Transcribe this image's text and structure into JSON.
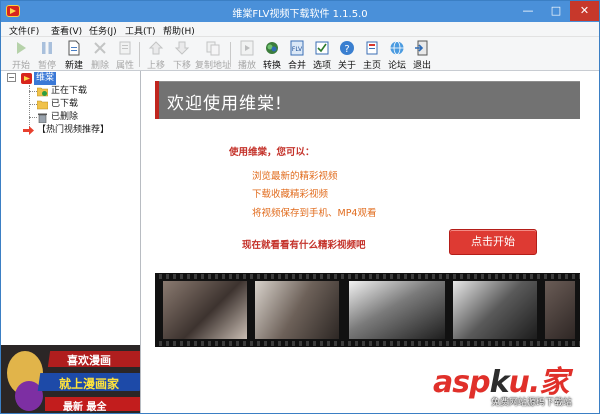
{
  "window": {
    "title": "维棠FLV视频下载软件 1.1.5.0",
    "controls": {
      "minimize": "—",
      "maximize": "□",
      "close": "✕"
    }
  },
  "menu": [
    "文件(F)",
    "查看(V)",
    "任务(J)",
    "工具(T)",
    "帮助(H)"
  ],
  "toolbar": {
    "start": "开始",
    "pause": "暂停",
    "new": "新建",
    "delete": "删除",
    "properties": "属性",
    "move_up": "上移",
    "move_down": "下移",
    "copy_url": "复制地址",
    "play": "播放",
    "convert": "转换",
    "merge": "合并",
    "options": "选项",
    "about": "关于",
    "home": "主页",
    "forum": "论坛",
    "exit": "退出"
  },
  "tree": {
    "root": "维棠",
    "downloading": "正在下载",
    "downloaded": "已下载",
    "deleted": "已删除",
    "recommend": "【热门视频推荐】"
  },
  "ad": {
    "line1": "喜欢漫画",
    "line2": "就上漫画家",
    "line3": "最新 最全"
  },
  "welcome": {
    "title": "欢迎使用维棠!",
    "intro": "使用维棠，您可以：",
    "bullets": [
      "浏览最新的精彩视频",
      "下载收藏精彩视频",
      "将视频保存到手机、MP4观看"
    ],
    "cta": "现在就看看有什么精彩视频吧",
    "start_button": "点击开始"
  },
  "watermark": {
    "main_a": "asp",
    "main_k": "k",
    "main_u": "u",
    "tail": ".家",
    "sub": "免费网站源码下载站"
  },
  "colors": {
    "titlebar": "#4a90d9",
    "header_gray": "#727272",
    "accent_red": "#c4322a",
    "orange": "#e16c1e"
  }
}
